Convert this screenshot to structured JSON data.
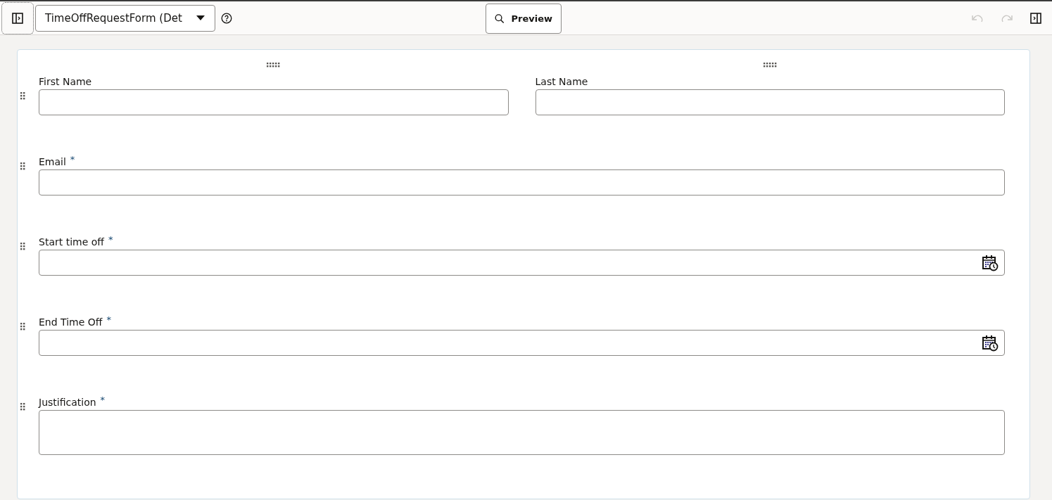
{
  "toolbar": {
    "form_selector": "TimeOffRequestForm (Det",
    "preview_button": "Preview",
    "undo": {
      "disabled": true
    },
    "redo": {
      "disabled": true
    }
  },
  "form_rows": [
    {
      "fields": [
        {
          "label": "First Name",
          "kind": "text"
        },
        {
          "label": "Last Name",
          "kind": "text"
        }
      ]
    },
    {
      "fields": [
        {
          "label": "Email",
          "required_mark": "*",
          "kind": "text"
        }
      ]
    },
    {
      "fields": [
        {
          "label": "Start time off",
          "required_mark": "*",
          "kind": "datetime"
        }
      ]
    },
    {
      "fields": [
        {
          "label": "End Time Off",
          "required_mark": "*",
          "kind": "datetime"
        }
      ]
    },
    {
      "fields": [
        {
          "label": "Justification",
          "required_mark": "*",
          "kind": "textarea"
        }
      ]
    }
  ]
}
